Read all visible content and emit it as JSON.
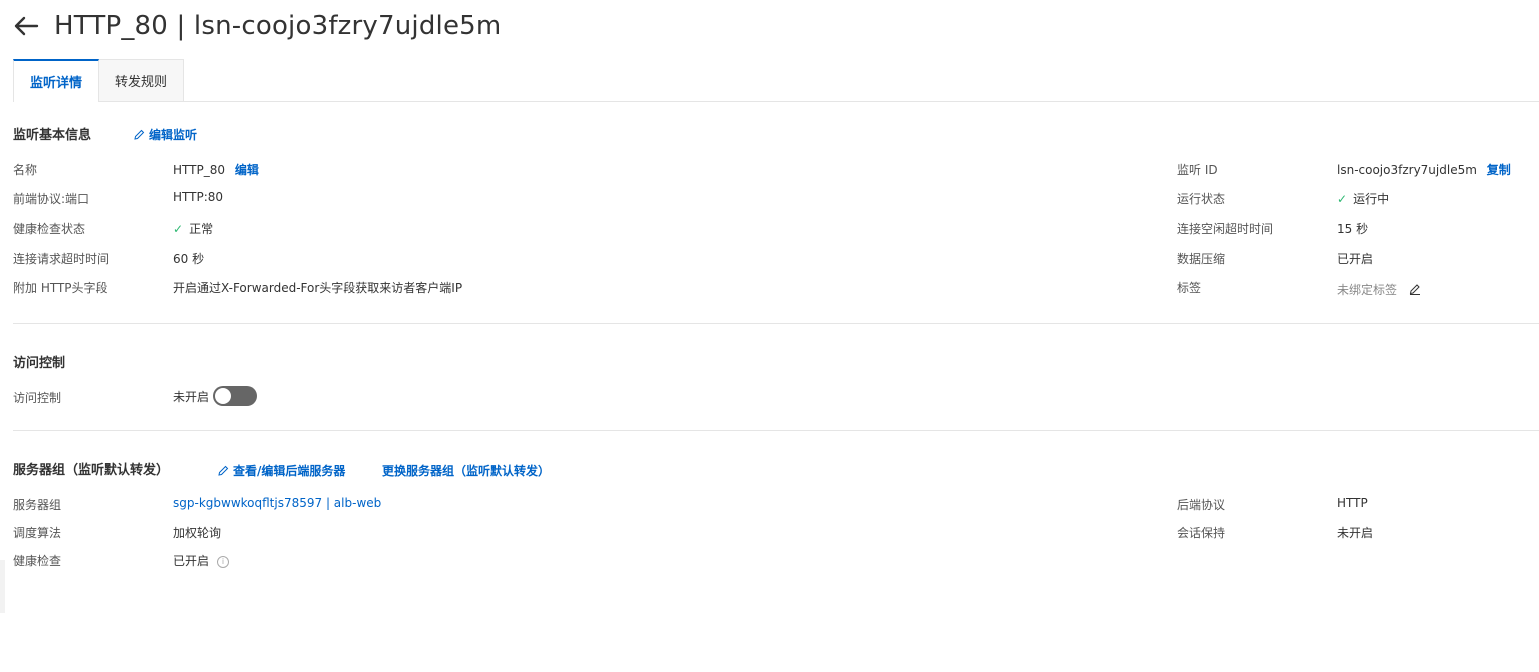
{
  "header": {
    "title": "HTTP_80 | lsn-coojo3fzry7ujdle5m"
  },
  "tabs": [
    {
      "label": "监听详情",
      "active": true
    },
    {
      "label": "转发规则",
      "active": false
    }
  ],
  "basic": {
    "title": "监听基本信息",
    "edit_link": "编辑监听",
    "left": [
      {
        "label": "名称",
        "value": "HTTP_80",
        "action": "编辑"
      },
      {
        "label": "前端协议:端口",
        "value": "HTTP:80"
      },
      {
        "label": "健康检查状态",
        "value": "正常"
      },
      {
        "label": "连接请求超时时间",
        "value": "60 秒"
      },
      {
        "label": "附加 HTTP头字段",
        "value": "开启通过X-Forwarded-For头字段获取来访者客户端IP"
      }
    ],
    "right": [
      {
        "label": "监听 ID",
        "value": "lsn-coojo3fzry7ujdle5m",
        "action": "复制"
      },
      {
        "label": "运行状态",
        "value": "运行中"
      },
      {
        "label": "连接空闲超时时间",
        "value": "15 秒"
      },
      {
        "label": "数据压缩",
        "value": "已开启"
      },
      {
        "label": "标签",
        "value": "未绑定标签"
      }
    ]
  },
  "access": {
    "title": "访问控制",
    "label": "访问控制",
    "value": "未开启"
  },
  "server_group": {
    "title": "服务器组（监听默认转发）",
    "link1": "查看/编辑后端服务器",
    "link2": "更换服务器组（监听默认转发）",
    "left": [
      {
        "label": "服务器组",
        "value": "sgp-kgbwwkoqfltjs78597 | alb-web"
      },
      {
        "label": "调度算法",
        "value": "加权轮询"
      },
      {
        "label": "健康检查",
        "value": "已开启"
      }
    ],
    "right": [
      {
        "label": "后端协议",
        "value": "HTTP"
      },
      {
        "label": "会话保持",
        "value": "未开启"
      }
    ]
  },
  "colors": {
    "accent": "#0064c8",
    "success": "#2eb872",
    "divider": "#e5e5e5"
  },
  "icons": {
    "back": "arrow-left-icon",
    "edit": "pencil-icon",
    "check": "check-icon",
    "info": "info-icon"
  }
}
